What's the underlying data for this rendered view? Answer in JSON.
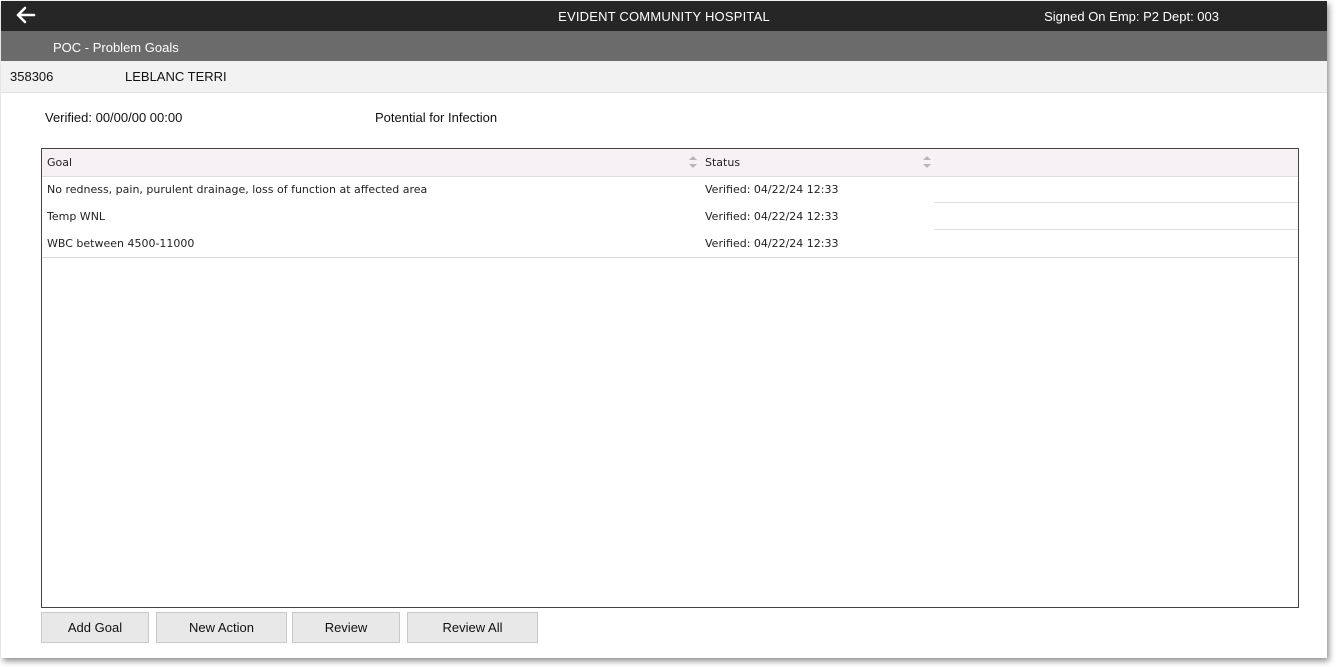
{
  "header": {
    "app_title": "EVIDENT COMMUNITY HOSPITAL",
    "signed_on": "Signed On Emp: P2 Dept: 003",
    "back_icon": "back-arrow-icon"
  },
  "subheader": {
    "title": "POC - Problem Goals"
  },
  "patient": {
    "id": "358306",
    "name": "LEBLANC TERRI"
  },
  "problem": {
    "verified": "Verified: 00/00/00 00:00",
    "name": "Potential for Infection"
  },
  "grid": {
    "columns": [
      {
        "label": "Goal",
        "sort_icon": "sort-arrows-icon"
      },
      {
        "label": "Status",
        "sort_icon": "sort-arrows-icon"
      }
    ],
    "rows": [
      {
        "goal": "No redness, pain, purulent drainage, loss of function at affected area",
        "status": "Verified: 04/22/24 12:33"
      },
      {
        "goal": "Temp WNL",
        "status": "Verified: 04/22/24 12:33"
      },
      {
        "goal": "WBC between 4500-11000",
        "status": "Verified: 04/22/24 12:33"
      }
    ]
  },
  "buttons": {
    "add_goal": "Add Goal",
    "new_action": "New Action",
    "review": "Review",
    "review_all": "Review All"
  },
  "colors": {
    "topbar": "#262626",
    "subbar": "#6b6b6b",
    "patientbar": "#f2f2f2",
    "grid_header": "#f7f1f5",
    "button": "#e8e8e8"
  }
}
